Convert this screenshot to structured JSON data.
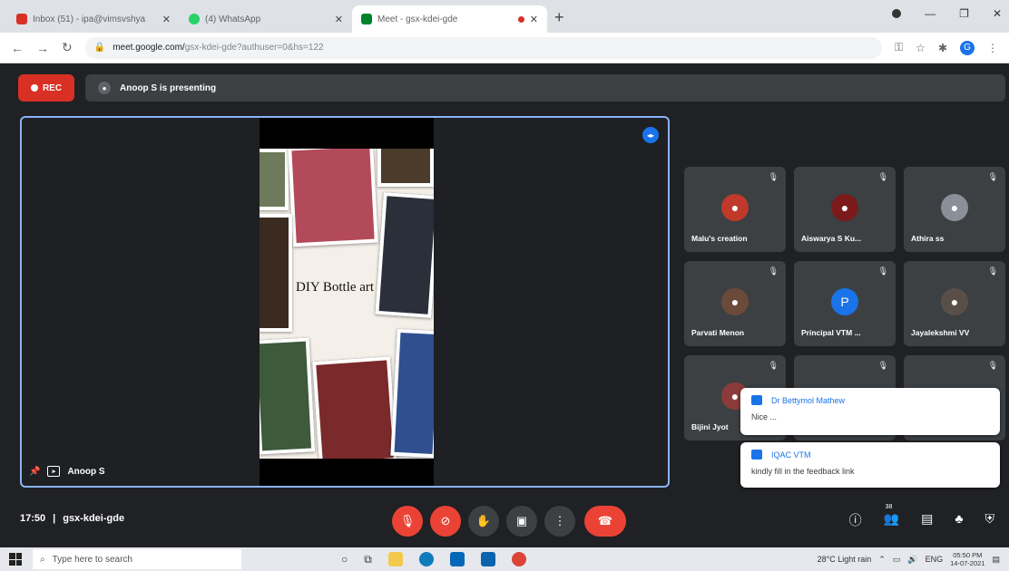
{
  "browser": {
    "tabs": [
      {
        "title": "Inbox (51) - ipa@vimsvshya",
        "favicon_color": "#d93025",
        "active": false
      },
      {
        "title": "(4) WhatsApp",
        "favicon_color": "#25d366",
        "active": false
      },
      {
        "title": "Meet - gsx-kdei-gde",
        "favicon_color": "#00832d",
        "active": true
      }
    ],
    "url": "meet.google.com/",
    "url_rest": "gsx-kdei-gde?authuser=0&hs=122",
    "new_tab": "+"
  },
  "meet": {
    "rec_label": "REC",
    "presenting_text": "Anoop S is presenting",
    "stage": {
      "presenter_name": "Anoop S",
      "slide_title": "DIY Bottle art"
    },
    "participants": [
      {
        "name": "Malu's creation",
        "avatar_color": "#c0392b",
        "initial": "●"
      },
      {
        "name": "Aiswarya S Ku...",
        "avatar_color": "#7a1a1a",
        "initial": "●"
      },
      {
        "name": "Athira ss",
        "avatar_color": "#8a8f99",
        "initial": "●"
      },
      {
        "name": "Parvati Menon",
        "avatar_color": "#6b4a3a",
        "initial": "●"
      },
      {
        "name": "Principal VTM ...",
        "avatar_color": "#1a73e8",
        "initial": "P"
      },
      {
        "name": "Jayalekshmi VV",
        "avatar_color": "#5a4f48",
        "initial": "●"
      },
      {
        "name": "Bijini Jyot",
        "avatar_color": "#8c3b3b",
        "initial": "●"
      }
    ],
    "notifications": [
      {
        "sender": "Dr Bettymol Mathew",
        "message": "Nice ..."
      },
      {
        "sender": "IQAC VTM",
        "message": "kindly fill in the feedback link"
      }
    ],
    "bottom": {
      "time": "17:50",
      "separator": "|",
      "meeting_code": "gsx-kdei-gde",
      "people_count": "38"
    }
  },
  "taskbar": {
    "search_placeholder": "Type here to search",
    "weather": "28°C  Light rain",
    "lang": "ENG",
    "time": "05:50 PM",
    "date": "14-07-2021"
  }
}
